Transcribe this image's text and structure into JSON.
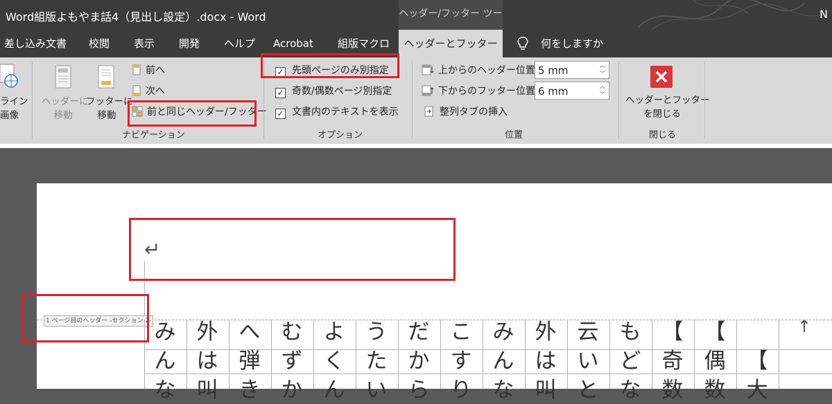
{
  "window": {
    "title": "Word組版よもやま話4（見出し設定）.docx - Word",
    "tool_context": "ヘッダー/フッター ツール",
    "right_initial": "N"
  },
  "tabs": [
    "差し込み文書",
    "校閲",
    "表示",
    "開発",
    "ヘルプ",
    "Acrobat",
    "組版マクロ",
    "ヘッダーとフッター"
  ],
  "tell_me": "何をしますか",
  "ribbon": {
    "partial_group": {
      "line1": "ライン",
      "line2": "画像"
    },
    "navigation": {
      "label": "ナビゲーション",
      "goto_header_1": "ヘッダーに",
      "goto_header_2": "移動",
      "goto_footer_1": "フッターに",
      "goto_footer_2": "移動",
      "previous": "前へ",
      "next": "次へ",
      "link_previous": "前と同じヘッダー/フッター"
    },
    "options": {
      "label": "オプション",
      "different_first": "先頭ページのみ別指定",
      "different_odd_even": "奇数/偶数ページ別指定",
      "show_document_text": "文書内のテキストを表示"
    },
    "position": {
      "label": "位置",
      "header_from_top": "上からのヘッダー位置:",
      "header_value": "5 mm",
      "footer_from_bottom": "下からのフッター位置:",
      "footer_value": "6 mm",
      "insert_alignment_tab": "整列タブの挿入"
    },
    "close": {
      "label": "閉じる",
      "line1": "ヘッダーとフッター",
      "line2": "を閉じる"
    }
  },
  "document": {
    "paragraph_mark": "↵",
    "header_tag": "1 ページ目のヘッダー -セクション 2-",
    "return_mark": "↑",
    "row1": [
      "み",
      "外",
      "へ",
      "む",
      "よ",
      "う",
      "だ",
      "こ",
      "み",
      "外",
      "云",
      "も"
    ],
    "row2": [
      "ん",
      "は",
      "弾",
      "ず",
      "く",
      "た",
      "か",
      "す",
      "ん",
      "は",
      "い",
      "ど"
    ],
    "row3": [
      "な",
      "叫",
      "き",
      "か",
      "ん",
      "い",
      "ら",
      "り",
      "な",
      "叫",
      "と",
      "な"
    ],
    "bracket_col1": [
      "【",
      "奇",
      "数"
    ],
    "bracket_col2": [
      "【",
      "偶",
      "数"
    ],
    "bracket_col3": [
      "【",
      "大"
    ]
  },
  "colors": {
    "highlight": "#e0202a",
    "ribbon_bg": "#d9d9d9",
    "titlebar_bg": "#3b3b3b",
    "close_icon": "#d9363e"
  }
}
